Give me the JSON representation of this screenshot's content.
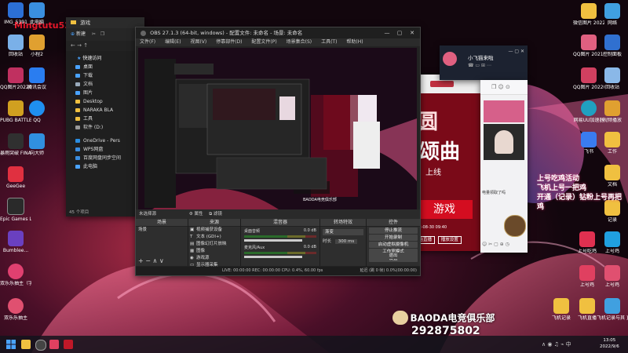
{
  "desktop": {
    "overlay_username": "Mingtutu521",
    "promo_logo_text": "BAODA电竞俱乐部",
    "promo_number": "292875802",
    "left_icons": [
      {
        "label": "IMG_5391",
        "color": "#2c6fd6"
      },
      {
        "label": "此电脑",
        "color": "#3a8fe0"
      },
      {
        "label": "回收站",
        "color": "#7ab0e8"
      },
      {
        "label": "小程2",
        "color": "#e0a030"
      },
      {
        "label": "腾讯会议",
        "color": "#2a7df0"
      },
      {
        "label": "QQ图片20220803...",
        "color": "#c03060"
      },
      {
        "label": "QQ",
        "color": "#1f8ff0"
      },
      {
        "label": "PUBG BATTLEGR...",
        "color": "#d0a020"
      },
      {
        "label": "向大师",
        "color": "#3090e0"
      },
      {
        "label": "暴雨突破 FINAL BETA",
        "color": "#303030"
      },
      {
        "label": "GeeGee",
        "color": "#e03040"
      },
      {
        "label": "Epic Games Launcher",
        "color": "#2a2a2a"
      },
      {
        "label": "Bumblee...",
        "color": "#6a40c0"
      },
      {
        "label": "双乐乐抽主（字谜解题解）",
        "color": "#e04070"
      },
      {
        "label": "双乐乐抽主",
        "color": "#e05070"
      }
    ],
    "right_icons": [
      {
        "label": "微信图片 20220...",
        "color": "#f0c040"
      },
      {
        "label": "网络",
        "color": "#40a0e0"
      },
      {
        "label": "QQ图片 20211204...",
        "color": "#e06080"
      },
      {
        "label": "控制面板",
        "color": "#3070d0"
      },
      {
        "label": "QQ图片 20220223...",
        "color": "#d04060"
      },
      {
        "label": "回收站",
        "color": "#8ab8e8"
      },
      {
        "label": "网易UU加速器",
        "color": "#20a0c0"
      },
      {
        "label": "视频播放",
        "color": "#e0a030"
      },
      {
        "label": "飞书",
        "color": "#3a7cf0"
      },
      {
        "label": "工作",
        "color": "#f0c040"
      },
      {
        "label": "文档",
        "color": "#f0c040"
      },
      {
        "label": "上号吃鸡",
        "color": "#e03050"
      },
      {
        "label": "记录",
        "color": "#f0c040"
      },
      {
        "label": "上号鸡",
        "color": "#e04060"
      },
      {
        "label": "上号鸡",
        "color": "#20a0e0"
      },
      {
        "label": "上号鸡",
        "color": "#e05070"
      },
      {
        "label": "飞机记录",
        "color": "#f0c040"
      },
      {
        "label": "飞机直播",
        "color": "#f0c040"
      },
      {
        "label": "飞机记录与其 直播文件夹",
        "color": "#40a0e0"
      }
    ],
    "promo_lines": [
      "上号吃鸡活动",
      "飞机上号一把鸡",
      "开通（记录）钻粉上号再把鸡"
    ]
  },
  "file_explorer": {
    "title": "游戏",
    "new_button": "新建",
    "quick_access": "快速访问",
    "items": [
      {
        "label": "桌面",
        "color": "#4aa3ff"
      },
      {
        "label": "下载",
        "color": "#4aa3ff"
      },
      {
        "label": "文档",
        "color": "#9ab"
      },
      {
        "label": "图片",
        "color": "#4aa3ff"
      },
      {
        "label": "Desktop",
        "color": "#f0c040"
      },
      {
        "label": "NARAKA  BLA",
        "color": "#f0c040"
      },
      {
        "label": "工具",
        "color": "#f0c040"
      },
      {
        "label": "软件 (D:)",
        "color": "#999"
      }
    ],
    "items2": [
      {
        "label": "OneDrive - Pers",
        "color": "#2a8de0"
      },
      {
        "label": "WPS网盘",
        "color": "#3a8de0"
      },
      {
        "label": "百度网盘同步空间",
        "color": "#3a8de0"
      },
      {
        "label": "此电脑",
        "color": "#4aa3ff"
      }
    ],
    "status": "45 个项目"
  },
  "obs": {
    "title": "OBS 27.1.3 (64-bit, windows) - 配置文件: 未命名 - 场景: 未命名",
    "menu": [
      "文件(F)",
      "编辑(E)",
      "视图(V)",
      "停靠部件(D)",
      "配置文件(P)",
      "场景集合(S)",
      "工具(T)",
      "帮助(H)"
    ],
    "not_selected": "未选择源",
    "props_button": "属性",
    "filters_button": "滤镜",
    "docks": {
      "scenes": "场景",
      "sources": "来源",
      "mixer": "混音器",
      "transitions": "转场特效",
      "controls": "控件"
    },
    "scenes": [
      "场景"
    ],
    "sources": [
      "视频捕获设备",
      "文本 (GDI+)",
      "图像幻灯片放映",
      "图像",
      "游戏源",
      "显示器采集"
    ],
    "mixer": [
      {
        "name": "桌面音频",
        "value": "0.0 dB"
      },
      {
        "name": "麦克风/Aux",
        "value": "0.0 dB"
      }
    ],
    "transition_value": "渐变",
    "duration_label": "时长",
    "duration_value": "300 ms",
    "controls": [
      "停止推流",
      "开始录制",
      "启动虚拟摄像机",
      "工作室模式",
      "设置",
      "退出"
    ],
    "status": "LIVE: 00:00:00  REC: 00:00:00  CPU: 0.4%, 60.00 fps",
    "status_right": "延迟 (跳 0 帧) 0.0%(00:00:00)"
  },
  "live_page": {
    "banner_big": "圆",
    "banner_sub": "颂曲",
    "banner_line": "上线",
    "game_title": "游戏",
    "date": "2022-08-30 09:40",
    "actions": [
      "开始直播",
      "播放设置"
    ]
  },
  "qq_chat": {
    "contact": "小飞猫来啦",
    "message": "电量领取了吗"
  },
  "taskbar": {
    "time": "13:05",
    "date": "2022/9/6"
  }
}
